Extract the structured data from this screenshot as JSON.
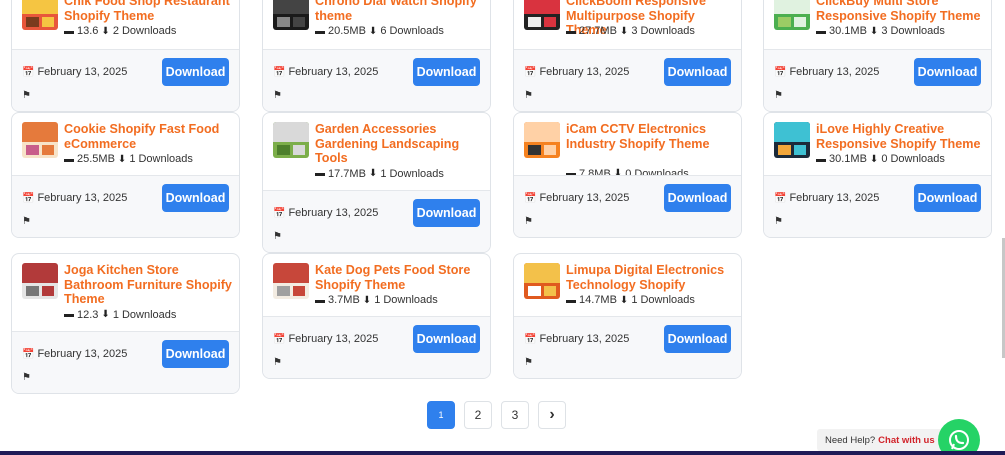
{
  "colors": {
    "title": "#f26d21",
    "button": "#2f80ed",
    "whatsapp": "#25d366"
  },
  "products": [
    {
      "title": "Chik Food Shop Restaurant Shopify Theme",
      "size": "13.6",
      "downloads": "2 Downloads",
      "date": "February 13, 2025",
      "button": "Download",
      "thumb": [
        "#e8563b",
        "#f5c542",
        "#7a3b1e"
      ]
    },
    {
      "title": "Chrono Dial Watch Shopify theme",
      "size": "20.5MB",
      "downloads": "6 Downloads",
      "date": "February 13, 2025",
      "button": "Download",
      "thumb": [
        "#1a1a1a",
        "#444444",
        "#888888"
      ]
    },
    {
      "title": "ClickBoom Responsive Multipurpose Shopify Theme",
      "size": "27.7MB",
      "downloads": "3 Downloads",
      "date": "February 13, 2025",
      "button": "Download",
      "thumb": [
        "#222222",
        "#d9333f",
        "#eeeeee"
      ]
    },
    {
      "title": "ClickBuy Multi Store Responsive Shopify Theme",
      "size": "30.1MB",
      "downloads": "3 Downloads",
      "date": "February 13, 2025",
      "button": "Download",
      "thumb": [
        "#4caf50",
        "#e0f2e0",
        "#9ccc65"
      ]
    },
    {
      "title": "Cookie Shopify Fast Food eCommerce",
      "size": "25.5MB",
      "downloads": "1 Downloads",
      "date": "February 13, 2025",
      "button": "Download",
      "thumb": [
        "#f7e3c8",
        "#e57a3c",
        "#c85d8a"
      ]
    },
    {
      "title": "Garden Accessories Gardening Landscaping Tools",
      "size": "17.7MB",
      "downloads": "1 Downloads",
      "date": "February 13, 2025",
      "button": "Download",
      "thumb": [
        "#7cae4a",
        "#d9d9d9",
        "#4d7f2c"
      ]
    },
    {
      "title": "iCam CCTV Electronics Industry Shopify Theme",
      "size": "7.8MB",
      "downloads": "0 Downloads",
      "date": "February 13, 2025",
      "button": "Download",
      "thumb": [
        "#f58220",
        "#ffd1a6",
        "#333333"
      ]
    },
    {
      "title": "iLove Highly Creative Responsive Shopify Theme",
      "size": "30.1MB",
      "downloads": "0 Downloads",
      "date": "February 13, 2025",
      "button": "Download",
      "thumb": [
        "#1c2a3a",
        "#3ec1d3",
        "#f3a73b"
      ]
    },
    {
      "title": "Joga Kitchen Store Bathroom Furniture Shopify Theme",
      "size": "12.3",
      "downloads": "1 Downloads",
      "date": "February 13, 2025",
      "button": "Download",
      "thumb": [
        "#e5e5e5",
        "#b23a3a",
        "#777777"
      ]
    },
    {
      "title": "Kate Dog Pets Food Store Shopify Theme",
      "size": "3.7MB",
      "downloads": "1 Downloads",
      "date": "February 13, 2025",
      "button": "Download",
      "thumb": [
        "#f3ece2",
        "#c7473a",
        "#a0a0a0"
      ]
    },
    {
      "title": "Limupa Digital Electronics Technology Shopify",
      "size": "14.7MB",
      "downloads": "1 Downloads",
      "date": "February 13, 2025",
      "button": "Download",
      "thumb": [
        "#e05a1f",
        "#f3c14a",
        "#ffffff"
      ]
    }
  ],
  "pagination": {
    "pages": [
      "1",
      "2",
      "3"
    ],
    "current": "1",
    "next": "›"
  },
  "help": {
    "text": "Need Help?",
    "link": "Chat with us"
  }
}
